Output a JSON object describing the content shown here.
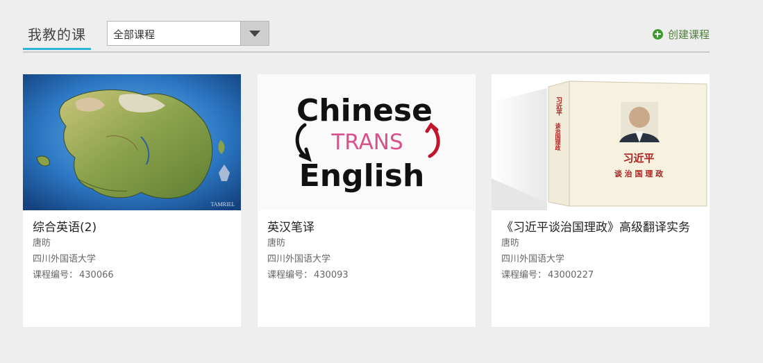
{
  "header": {
    "tab_label": "我教的课",
    "select_value": "全部课程",
    "create_label": "创建课程"
  },
  "courses": [
    {
      "title": "综合英语(2)",
      "teacher": "唐昉",
      "school": "四川外国语大学",
      "code_label": "课程编号：",
      "code": "430066",
      "thumb_logo": "TAMRIEL"
    },
    {
      "title": "英汉笔译",
      "teacher": "唐昉",
      "school": "四川外国语大学",
      "code_label": "课程编号：",
      "code": "430093",
      "thumb_line1": "Chinese",
      "thumb_line2": "TRANS",
      "thumb_line3": "English"
    },
    {
      "title": "《习近平谈治国理政》高级翻译实务",
      "teacher": "唐昉",
      "school": "四川外国语大学",
      "code_label": "课程编号：",
      "code": "43000227",
      "book_author": "习近平",
      "book_title": "谈 治 国 理 政",
      "spine_name": "习近平",
      "spine_title": "谈治国理政"
    }
  ],
  "colors": {
    "accent": "#2eb4d8",
    "create_green": "#3d9a2d",
    "background": "#eeeeee"
  }
}
